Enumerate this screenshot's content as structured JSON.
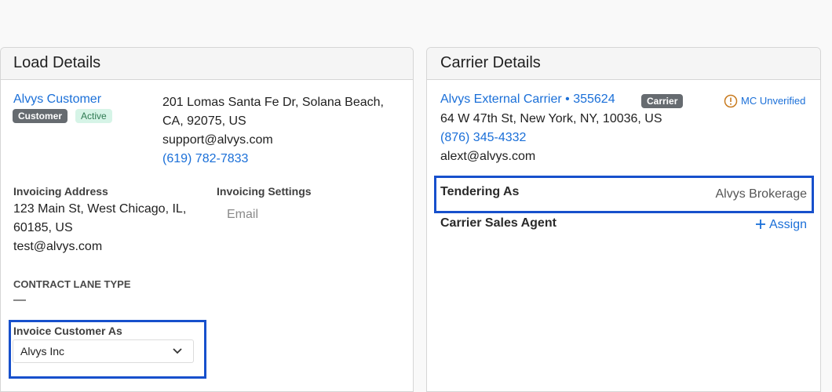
{
  "load_details": {
    "title": "Load Details",
    "customer": {
      "name": "Alvys Customer",
      "badge_type": "Customer",
      "badge_status": "Active",
      "address_line1": "201 Lomas Santa Fe Dr, Solana Beach,",
      "address_line2": "CA, 92075, US",
      "email": "support@alvys.com",
      "phone": "(619) 782-7833"
    },
    "invoicing_address": {
      "label": "Invoicing Address",
      "line1": "123 Main St, West Chicago, IL,",
      "line2": "60185, US",
      "email": "test@alvys.com"
    },
    "invoicing_settings": {
      "label": "Invoicing Settings",
      "value": "Email"
    },
    "contract_lane_type": {
      "label": "CONTRACT LANE TYPE",
      "value": "—"
    },
    "invoice_customer_as": {
      "label": "Invoice Customer As",
      "selected": "Alvys Inc"
    }
  },
  "carrier_details": {
    "title": "Carrier Details",
    "carrier": {
      "name": "Alvys External Carrier • 355624",
      "badge": "Carrier",
      "mc_status": "MC Unverified",
      "address": "64 W 47th St, New York, NY, 10036, US",
      "phone": "(876) 345-4332",
      "email": "alext@alvys.com"
    },
    "tendering_as": {
      "label": "Tendering As",
      "value": "Alvys Brokerage"
    },
    "carrier_sales_agent": {
      "label": "Carrier Sales Agent",
      "assign_label": "Assign"
    }
  },
  "colors": {
    "link": "#1a6fd8",
    "highlight": "#1750cc",
    "warning": "#c87a1e"
  },
  "icons": {
    "mc_warning": "alert-circle-icon",
    "assign": "plus-icon",
    "dropdown": "chevron-down-icon"
  }
}
